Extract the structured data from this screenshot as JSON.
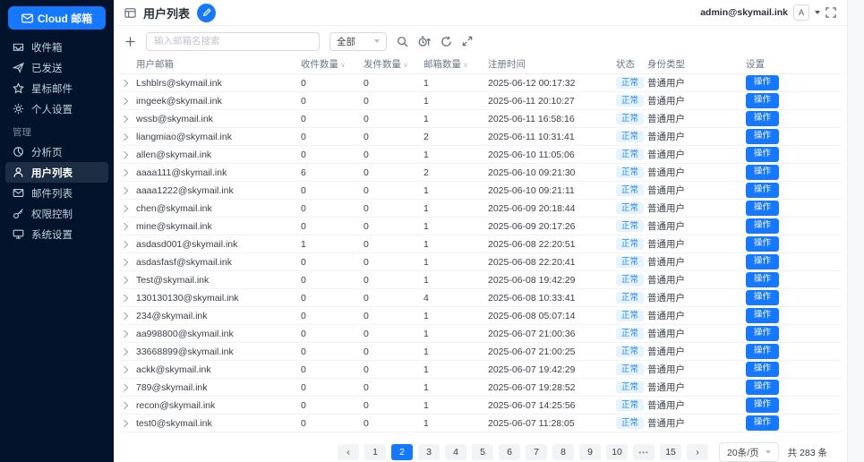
{
  "colors": {
    "accent": "#1677ff",
    "sidebar_bg": "#02132b",
    "sidebar_active_bg": "#1d2d44",
    "badge_bg": "#e6f4ff",
    "badge_text": "#2a87f5"
  },
  "sidebar": {
    "logo_label": "Cloud 邮箱",
    "logo_icon": "mail-logo-icon",
    "sections": [
      {
        "label": "",
        "items": [
          {
            "id": "inbox",
            "label": "收件箱",
            "icon": "inbox-icon",
            "active": false
          },
          {
            "id": "sent",
            "label": "已发送",
            "icon": "send-icon",
            "active": false
          },
          {
            "id": "starred",
            "label": "星标邮件",
            "icon": "star-icon",
            "active": false
          },
          {
            "id": "personal-settings",
            "label": "个人设置",
            "icon": "gear-icon",
            "active": false
          }
        ]
      },
      {
        "label": "管理",
        "items": [
          {
            "id": "analytics",
            "label": "分析页",
            "icon": "chart-icon",
            "active": false
          },
          {
            "id": "user-list",
            "label": "用户列表",
            "icon": "user-icon",
            "active": true
          },
          {
            "id": "mail-list",
            "label": "邮件列表",
            "icon": "mail-icon",
            "active": false
          },
          {
            "id": "permissions",
            "label": "权限控制",
            "icon": "key-icon",
            "active": false
          },
          {
            "id": "system-settings",
            "label": "系统设置",
            "icon": "monitor-icon",
            "active": false
          }
        ]
      }
    ]
  },
  "header": {
    "title": "用户列表",
    "account": "admin@skymail.ink",
    "avatar_letter": "A",
    "icons": [
      "collapse-sidebar-icon",
      "edit-icon",
      "caret-down-icon",
      "fullscreen-icon"
    ]
  },
  "toolbar": {
    "add_icon": "plus-icon",
    "search_placeholder": "输入邮箱名搜索",
    "filter_value": "全部",
    "icons": [
      "search-icon",
      "timer-icon",
      "refresh-icon",
      "expand-icon"
    ]
  },
  "table": {
    "columns": [
      {
        "key": "email",
        "label": "用户邮箱",
        "sortable": false
      },
      {
        "key": "received",
        "label": "收件数量",
        "sortable": true
      },
      {
        "key": "sent",
        "label": "发件数量",
        "sortable": true
      },
      {
        "key": "boxes",
        "label": "邮箱数量",
        "sortable": true
      },
      {
        "key": "registered",
        "label": "注册时间",
        "sortable": false
      },
      {
        "key": "status",
        "label": "状态",
        "sortable": false
      },
      {
        "key": "role",
        "label": "身份类型",
        "sortable": false
      },
      {
        "key": "settings",
        "label": "设置",
        "sortable": false
      }
    ],
    "rows": [
      [
        "Lshblrs@skymail.ink",
        "0",
        "0",
        "1",
        "2025-06-12 00:17:32",
        "正常",
        "普通用户",
        "操作"
      ],
      [
        "imgeek@skymail.ink",
        "0",
        "0",
        "1",
        "2025-06-11 20:10:27",
        "正常",
        "普通用户",
        "操作"
      ],
      [
        "wssb@skymail.ink",
        "0",
        "0",
        "1",
        "2025-06-11 16:58:16",
        "正常",
        "普通用户",
        "操作"
      ],
      [
        "liangmiao@skymail.ink",
        "0",
        "0",
        "2",
        "2025-06-11 10:31:41",
        "正常",
        "普通用户",
        "操作"
      ],
      [
        "allen@skymail.ink",
        "0",
        "0",
        "1",
        "2025-06-10 11:05:06",
        "正常",
        "普通用户",
        "操作"
      ],
      [
        "aaaa111@skymail.ink",
        "6",
        "0",
        "2",
        "2025-06-10 09:21:30",
        "正常",
        "普通用户",
        "操作"
      ],
      [
        "aaaa1222@skymail.ink",
        "0",
        "0",
        "1",
        "2025-06-10 09:21:11",
        "正常",
        "普通用户",
        "操作"
      ],
      [
        "chen@skymail.ink",
        "0",
        "0",
        "1",
        "2025-06-09 20:18:44",
        "正常",
        "普通用户",
        "操作"
      ],
      [
        "mine@skymail.ink",
        "0",
        "0",
        "1",
        "2025-06-09 20:17:26",
        "正常",
        "普通用户",
        "操作"
      ],
      [
        "asdasd001@skymail.ink",
        "1",
        "0",
        "1",
        "2025-06-08 22:20:51",
        "正常",
        "普通用户",
        "操作"
      ],
      [
        "asdasfasf@skymail.ink",
        "0",
        "0",
        "1",
        "2025-06-08 22:20:41",
        "正常",
        "普通用户",
        "操作"
      ],
      [
        "Test@skymail.ink",
        "0",
        "0",
        "1",
        "2025-06-08 19:42:29",
        "正常",
        "普通用户",
        "操作"
      ],
      [
        "130130130@skymail.ink",
        "0",
        "0",
        "4",
        "2025-06-08 10:33:41",
        "正常",
        "普通用户",
        "操作"
      ],
      [
        "234@skymail.ink",
        "0",
        "0",
        "1",
        "2025-06-08 05:07:14",
        "正常",
        "普通用户",
        "操作"
      ],
      [
        "aa998800@skymail.ink",
        "0",
        "0",
        "1",
        "2025-06-07 21:00:36",
        "正常",
        "普通用户",
        "操作"
      ],
      [
        "33668899@skymail.ink",
        "0",
        "0",
        "1",
        "2025-06-07 21:00:25",
        "正常",
        "普通用户",
        "操作"
      ],
      [
        "ackk@skymail.ink",
        "0",
        "0",
        "1",
        "2025-06-07 19:42:29",
        "正常",
        "普通用户",
        "操作"
      ],
      [
        "789@skymail.ink",
        "0",
        "0",
        "1",
        "2025-06-07 19:28:52",
        "正常",
        "普通用户",
        "操作"
      ],
      [
        "recon@skymail.ink",
        "0",
        "0",
        "1",
        "2025-06-07 14:25:56",
        "正常",
        "普通用户",
        "操作"
      ],
      [
        "test0@skymail.ink",
        "0",
        "0",
        "1",
        "2025-06-07 11:28:05",
        "正常",
        "普通用户",
        "操作"
      ]
    ]
  },
  "pagination": {
    "prev": "‹",
    "next": "›",
    "pages": [
      "1",
      "2",
      "3",
      "4",
      "5",
      "6",
      "7",
      "8",
      "9",
      "10",
      "•••",
      "15"
    ],
    "active_page": "2",
    "page_size_label": "20条/页",
    "total_label": "共 283 条"
  }
}
